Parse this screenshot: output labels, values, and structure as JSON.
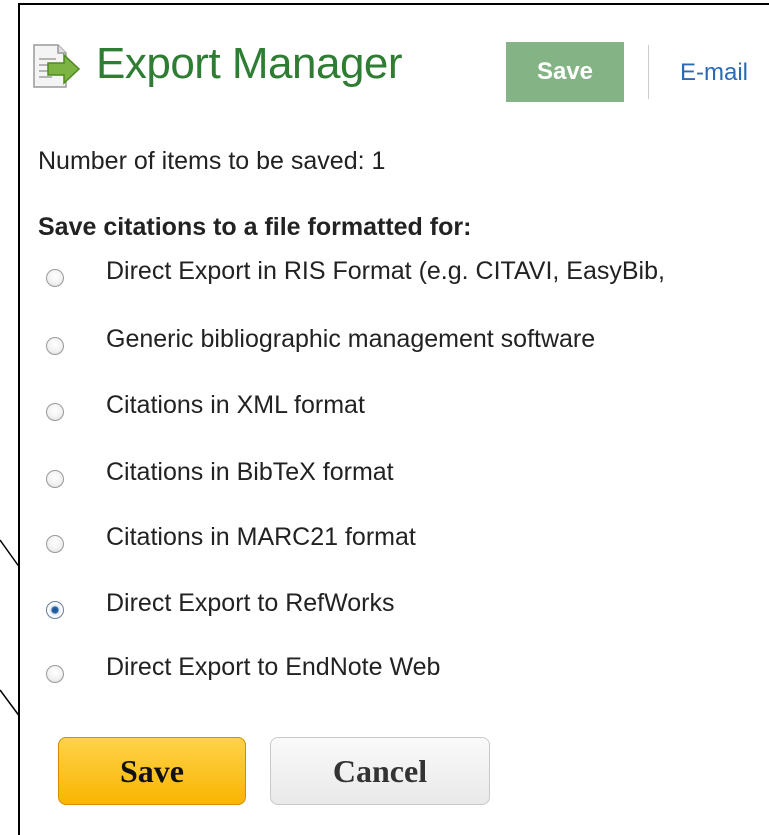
{
  "header": {
    "title": "Export Manager",
    "save_label": "Save",
    "email_label": "E-mail"
  },
  "count_text": "Number of items to be saved: 1",
  "section_heading": "Save citations to a file formatted for:",
  "options": [
    {
      "label": "Direct Export in RIS Format (e.g. CITAVI, EasyBib,",
      "checked": false
    },
    {
      "label": "Generic bibliographic management software",
      "checked": false
    },
    {
      "label": "Citations in XML format",
      "checked": false
    },
    {
      "label": "Citations in BibTeX format",
      "checked": false
    },
    {
      "label": "Citations in MARC21 format",
      "checked": false
    },
    {
      "label": "Direct Export to RefWorks",
      "checked": true
    },
    {
      "label": "Direct Export to EndNote Web",
      "checked": false
    }
  ],
  "buttons": {
    "save_label": "Save",
    "cancel_label": "Cancel"
  },
  "colors": {
    "title": "#2e7d32",
    "header_save_bg": "#84b486",
    "email_link": "#2a6ab4",
    "primary_button": "#f9b500",
    "secondary_button": "#ebebeb"
  },
  "icons": {
    "export": "export-document-arrow-icon"
  }
}
